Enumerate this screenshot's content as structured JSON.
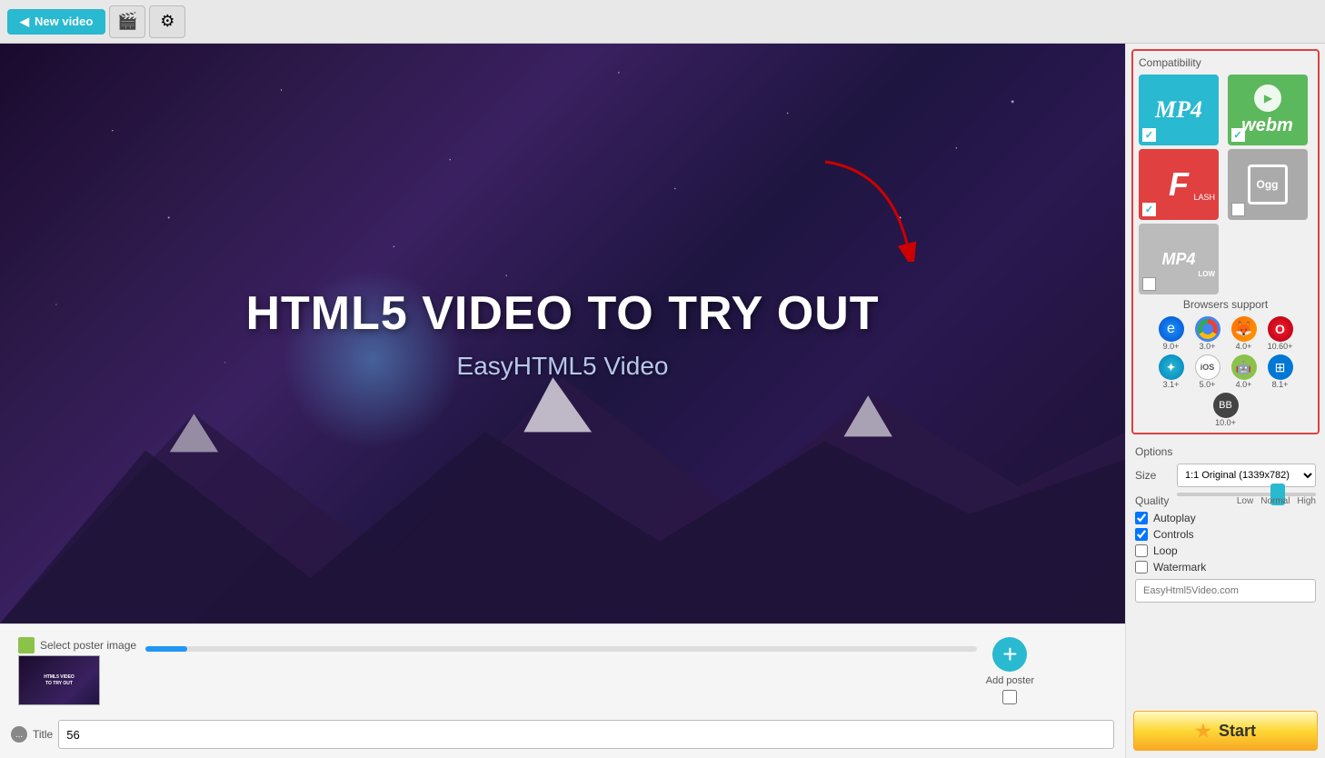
{
  "toolbar": {
    "new_video_label": "New video"
  },
  "video_preview": {
    "main_title": "HTML5 VIDEO TO TRY OUT",
    "sub_title": "EasyHTML5 Video"
  },
  "poster": {
    "select_label": "Select poster image",
    "add_label": "Add poster"
  },
  "title_field": {
    "label": "Title",
    "value": "56",
    "placeholder": ""
  },
  "compatibility": {
    "section_label": "Compatibility",
    "formats": [
      {
        "id": "mp4",
        "label": "MP4",
        "checked": true
      },
      {
        "id": "webm",
        "label": "webm",
        "checked": true
      },
      {
        "id": "flash",
        "label": "LASH",
        "checked": true
      },
      {
        "id": "ogg",
        "label": "Ogg",
        "checked": false
      },
      {
        "id": "mp4low",
        "label": "MP4 LOW",
        "checked": false
      }
    ]
  },
  "browsers": {
    "section_label": "Browsers support",
    "items": [
      {
        "name": "IE",
        "version": "9.0+"
      },
      {
        "name": "Chrome",
        "version": "3.0+"
      },
      {
        "name": "Firefox",
        "version": "4.0+"
      },
      {
        "name": "Opera",
        "version": "10.60+"
      },
      {
        "name": "Safari",
        "version": "3.1+"
      },
      {
        "name": "iOS",
        "version": "5.0+"
      },
      {
        "name": "Android",
        "version": "4.0+"
      },
      {
        "name": "Windows",
        "version": "8.1+"
      },
      {
        "name": "BlackBerry",
        "version": "10.0+"
      }
    ]
  },
  "options": {
    "section_label": "Options",
    "size_label": "Size",
    "size_badge": "1:1",
    "size_value": "Original (1339x782)",
    "quality_label": "Quality",
    "quality_levels": [
      "Low",
      "Normal",
      "High"
    ],
    "quality_value": 75,
    "autoplay_label": "Autoplay",
    "autoplay_checked": true,
    "controls_label": "Controls",
    "controls_checked": true,
    "loop_label": "Loop",
    "loop_checked": false,
    "watermark_label": "Watermark",
    "watermark_checked": false,
    "watermark_placeholder": "EasyHtml5Video.com"
  },
  "start_button": {
    "label": "Start"
  }
}
